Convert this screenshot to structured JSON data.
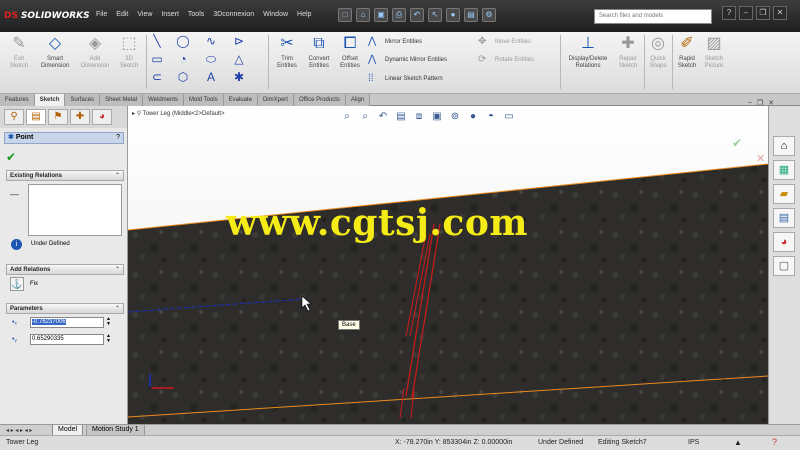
{
  "app": {
    "brand": "SOLIDWORKS",
    "brand_prefix": "DS"
  },
  "menu": [
    "File",
    "Edit",
    "View",
    "Insert",
    "Tools",
    "3Dconnexion",
    "Window",
    "Help"
  ],
  "search": {
    "placeholder": "Search files and models"
  },
  "command_manager": {
    "exit_sketch": "Exit Sketch",
    "smart_dimension": "Smart Dimension",
    "add_dimension": "Add Dimension",
    "3d_sketch": "3D Sketch",
    "trim_entities": "Trim Entities",
    "convert_entities": "Convert Entities",
    "offset_entities": "Offset Entities",
    "mirror_entities": "Mirror Entities",
    "dynamic_mirror": "Dynamic Mirror Entities",
    "linear_pattern": "Linear Sketch Pattern",
    "move_entities": "Move Entities",
    "rotate_entities": "Rotate Entities",
    "display_delete": "Display/Delete Relations",
    "repair_sketch": "Repair Sketch",
    "quick_snaps": "Quick Snaps",
    "rapid_sketch": "Rapid Sketch",
    "sketch_picture": "Sketch Picture"
  },
  "tabs": [
    "Features",
    "Sketch",
    "Surfaces",
    "Sheet Metal",
    "Weldments",
    "Mold Tools",
    "Evaluate",
    "DimXpert",
    "Office Products",
    "Align"
  ],
  "active_tab": "Sketch",
  "property_manager": {
    "title": "Point",
    "existing_relations": "Existing Relations",
    "status": "Under Defined",
    "add_relations": "Add Relations",
    "fix": "Fix",
    "parameters": "Parameters",
    "param_x": "-0.76237006",
    "param_y": "0.65290335"
  },
  "viewport": {
    "tree_label": "Tower Leg (Middle<2>Default>",
    "watermark": "www.cgtsj.com",
    "tooltip": "Base"
  },
  "bottom_tabs": [
    "Model",
    "Motion Study 1"
  ],
  "statusbar": {
    "doc": "Tower Leg",
    "coords": "X: -78.270in Y: 853304in Z: 0.00000in",
    "defined": "Under Defined",
    "editing": "Editing Sketch7",
    "units": "IPS"
  },
  "colors": {
    "accent": "#1d56b0",
    "sketch_red": "#cc1b1b",
    "watermark": "#f5eb16",
    "edge_orange": "#ef8a1e"
  }
}
